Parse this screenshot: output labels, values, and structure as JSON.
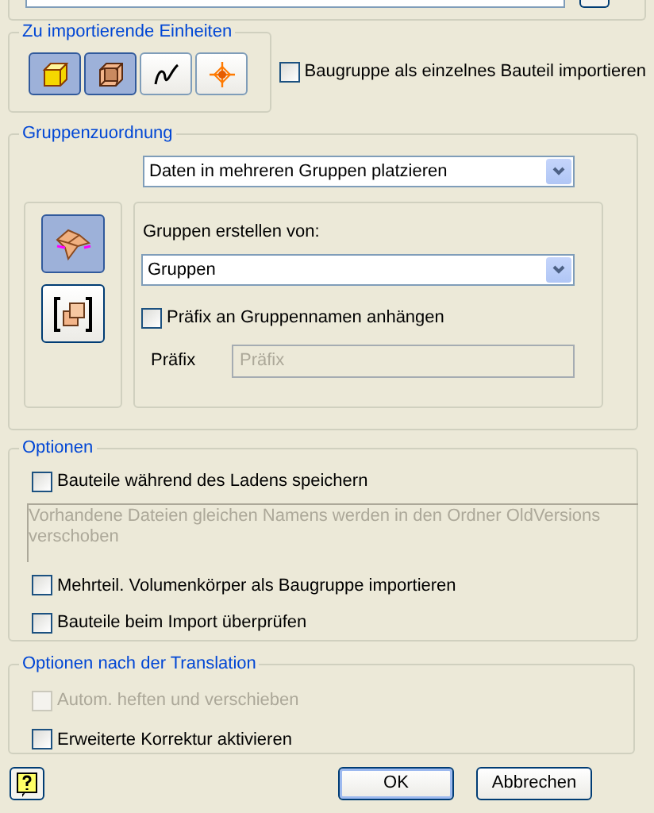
{
  "units": {
    "title": "Zu importierende Einheiten",
    "buttons": [
      {
        "kind": "solid",
        "selected": true
      },
      {
        "kind": "surface",
        "selected": true
      },
      {
        "kind": "curve",
        "selected": false
      },
      {
        "kind": "point",
        "selected": false
      }
    ],
    "single_part_checkbox": {
      "label": "Baugruppe als einzelnes Bauteil importieren",
      "checked": false
    }
  },
  "group_assignment": {
    "title": "Gruppenzuordnung",
    "mode_dropdown": {
      "value": "Daten in mehreren Gruppen platzieren"
    },
    "mode_buttons": [
      {
        "kind": "groups",
        "selected": true
      },
      {
        "kind": "single",
        "selected": false
      }
    ],
    "create_from_label": "Gruppen erstellen von:",
    "create_from_dropdown": {
      "value": "Gruppen"
    },
    "prefix_checkbox": {
      "label": "Präfix an Gruppennamen anhängen",
      "checked": false
    },
    "prefix_label": "Präfix",
    "prefix_field": {
      "placeholder": "Präfix",
      "disabled": true
    }
  },
  "options": {
    "title": "Optionen",
    "items": [
      {
        "kind": "checkbox",
        "label": "Bauteile während des Ladens speichern",
        "checked": false,
        "disabled": false
      },
      {
        "kind": "note",
        "text": "Vorhandene Dateien gleichen Namens werden in den Ordner OldVersions verschoben"
      },
      {
        "kind": "checkbox",
        "label": "Mehrteil. Volumenkörper als Baugruppe importieren",
        "checked": false,
        "disabled": false
      },
      {
        "kind": "checkbox",
        "label": "Bauteile beim Import überprüfen",
        "checked": false,
        "disabled": false
      }
    ]
  },
  "post_translation": {
    "title": "Optionen nach der Translation",
    "items": [
      {
        "label": "Autom. heften und verschieben",
        "checked": false,
        "disabled": true
      },
      {
        "label": "Erweiterte Korrektur aktivieren",
        "checked": false,
        "disabled": false
      }
    ]
  },
  "buttons": [
    {
      "label": "OK",
      "default": true
    },
    {
      "label": "Abbrechen",
      "default": false
    }
  ]
}
